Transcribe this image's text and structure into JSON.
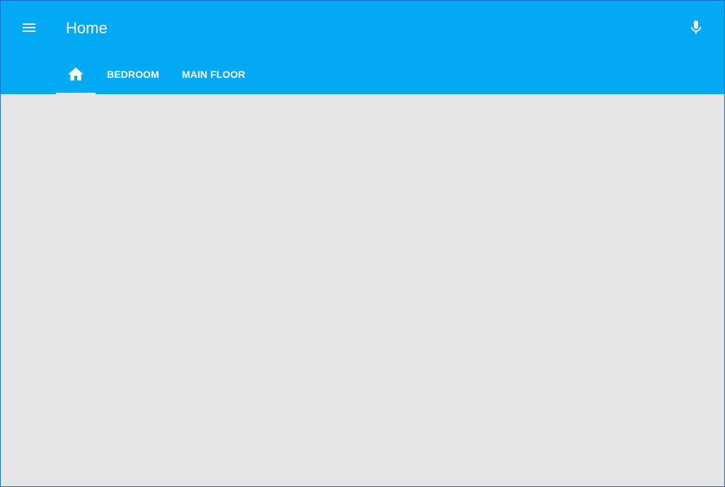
{
  "app_header": {
    "title": "Home",
    "menu_icon": "menu-icon",
    "voice_icon": "microphone-icon",
    "background_color": "#03a9f4"
  },
  "tabs": [
    {
      "icon": "home-icon",
      "active": true
    },
    {
      "label": "BEDROOM",
      "active": false
    },
    {
      "label": "MAIN FLOOR",
      "active": false
    }
  ],
  "content": {
    "background_color": "#e5e5e5"
  }
}
